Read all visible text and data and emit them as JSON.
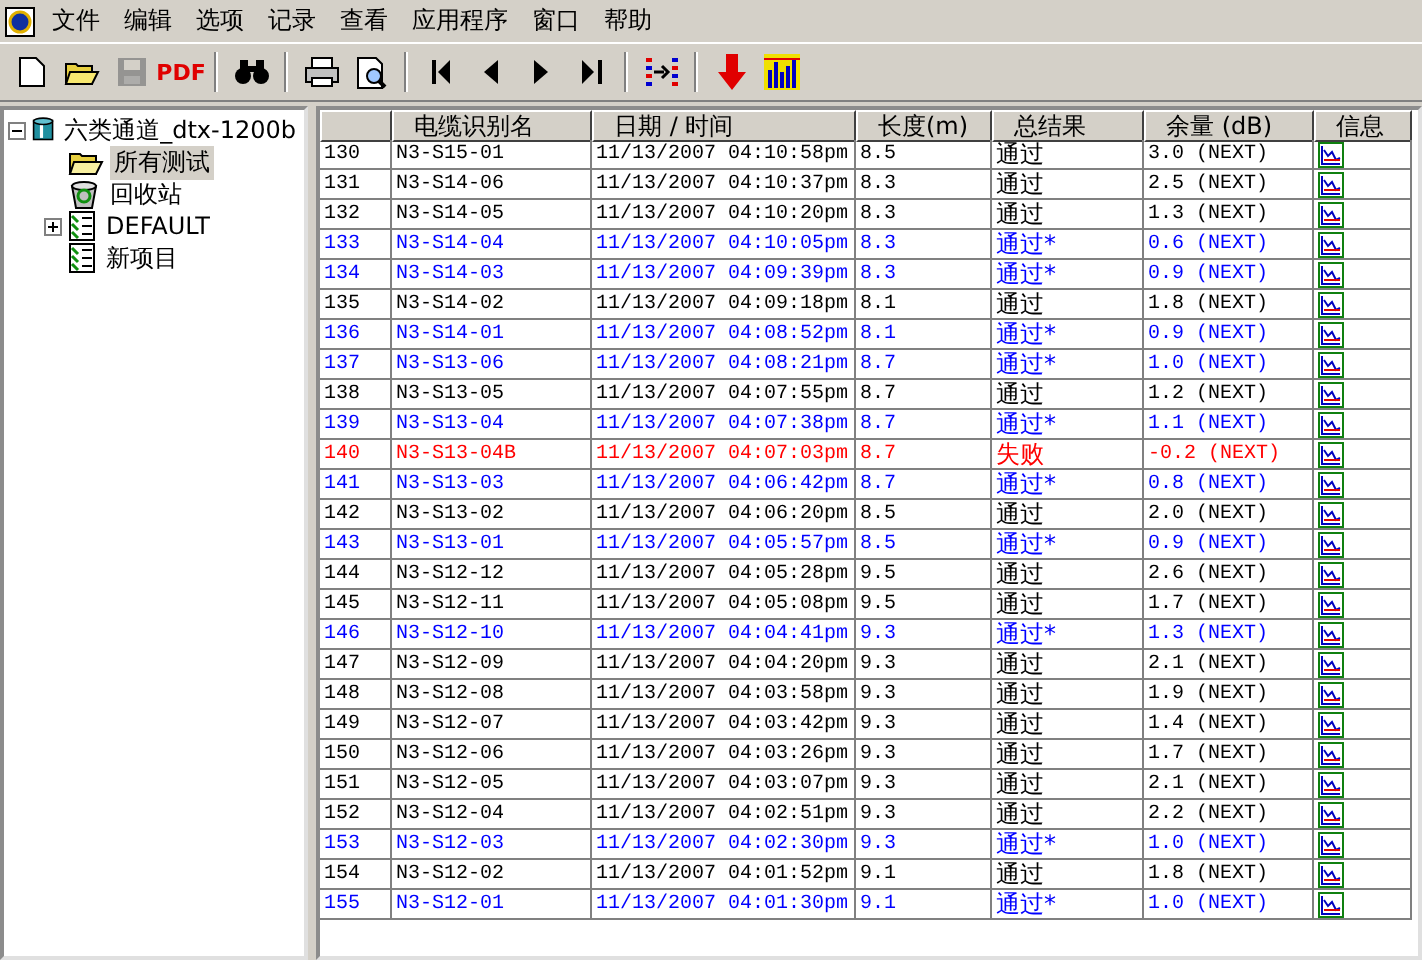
{
  "menu": [
    "文件",
    "编辑",
    "选项",
    "记录",
    "查看",
    "应用程序",
    "窗口",
    "帮助"
  ],
  "toolbar": [
    {
      "kind": "new",
      "disabled": false
    },
    {
      "kind": "open",
      "disabled": false
    },
    {
      "kind": "save",
      "disabled": true
    },
    {
      "kind": "pdf",
      "label": "PDF",
      "disabled": false
    },
    {
      "kind": "sep"
    },
    {
      "kind": "find",
      "disabled": false
    },
    {
      "kind": "sep"
    },
    {
      "kind": "print",
      "disabled": false
    },
    {
      "kind": "preview",
      "disabled": false
    },
    {
      "kind": "sep"
    },
    {
      "kind": "first",
      "disabled": false
    },
    {
      "kind": "prev",
      "disabled": false
    },
    {
      "kind": "next",
      "disabled": false
    },
    {
      "kind": "last",
      "disabled": false
    },
    {
      "kind": "sep"
    },
    {
      "kind": "compare",
      "disabled": false
    },
    {
      "kind": "sep"
    },
    {
      "kind": "down",
      "disabled": false
    },
    {
      "kind": "chart",
      "disabled": false
    }
  ],
  "tree": [
    {
      "label": "六类通道_dtx-1200b",
      "kind": "project",
      "expanded": true,
      "selected": false,
      "children": [
        {
          "label": "所有测试",
          "kind": "folder",
          "selected": true
        },
        {
          "label": "回收站",
          "kind": "trash",
          "selected": false
        },
        {
          "label": "DEFAULT",
          "kind": "list",
          "expanded": false,
          "selected": false
        },
        {
          "label": "新项目",
          "kind": "list",
          "selected": false
        }
      ]
    }
  ],
  "table": {
    "columns": [
      "",
      "电缆识别名",
      "日期 / 时间",
      "长度(m)",
      "总结果",
      "余量 (dB)",
      "信息"
    ],
    "rows": [
      {
        "no": "130",
        "name": "N3-S15-01",
        "datetime": "11/13/2007 04:10:58pm",
        "length": "8.5",
        "result": "通过",
        "margin": "3.0 (NEXT)",
        "color": "#000000"
      },
      {
        "no": "131",
        "name": "N3-S14-06",
        "datetime": "11/13/2007 04:10:37pm",
        "length": "8.3",
        "result": "通过",
        "margin": "2.5 (NEXT)",
        "color": "#000000"
      },
      {
        "no": "132",
        "name": "N3-S14-05",
        "datetime": "11/13/2007 04:10:20pm",
        "length": "8.3",
        "result": "通过",
        "margin": "1.3 (NEXT)",
        "color": "#000000"
      },
      {
        "no": "133",
        "name": "N3-S14-04",
        "datetime": "11/13/2007 04:10:05pm",
        "length": "8.3",
        "result": "通过*",
        "margin": "0.6 (NEXT)",
        "color": "#0000ff"
      },
      {
        "no": "134",
        "name": "N3-S14-03",
        "datetime": "11/13/2007 04:09:39pm",
        "length": "8.3",
        "result": "通过*",
        "margin": "0.9 (NEXT)",
        "color": "#0000ff"
      },
      {
        "no": "135",
        "name": "N3-S14-02",
        "datetime": "11/13/2007 04:09:18pm",
        "length": "8.1",
        "result": "通过",
        "margin": "1.8 (NEXT)",
        "color": "#000000"
      },
      {
        "no": "136",
        "name": "N3-S14-01",
        "datetime": "11/13/2007 04:08:52pm",
        "length": "8.1",
        "result": "通过*",
        "margin": "0.9 (NEXT)",
        "color": "#0000ff"
      },
      {
        "no": "137",
        "name": "N3-S13-06",
        "datetime": "11/13/2007 04:08:21pm",
        "length": "8.7",
        "result": "通过*",
        "margin": "1.0 (NEXT)",
        "color": "#0000ff"
      },
      {
        "no": "138",
        "name": "N3-S13-05",
        "datetime": "11/13/2007 04:07:55pm",
        "length": "8.7",
        "result": "通过",
        "margin": "1.2 (NEXT)",
        "color": "#000000"
      },
      {
        "no": "139",
        "name": "N3-S13-04",
        "datetime": "11/13/2007 04:07:38pm",
        "length": "8.7",
        "result": "通过*",
        "margin": "1.1 (NEXT)",
        "color": "#0000ff"
      },
      {
        "no": "140",
        "name": "N3-S13-04B",
        "datetime": "11/13/2007 04:07:03pm",
        "length": "8.7",
        "result": "失败",
        "margin": "-0.2 (NEXT)",
        "color": "#ff0000"
      },
      {
        "no": "141",
        "name": "N3-S13-03",
        "datetime": "11/13/2007 04:06:42pm",
        "length": "8.7",
        "result": "通过*",
        "margin": "0.8 (NEXT)",
        "color": "#0000ff"
      },
      {
        "no": "142",
        "name": "N3-S13-02",
        "datetime": "11/13/2007 04:06:20pm",
        "length": "8.5",
        "result": "通过",
        "margin": "2.0 (NEXT)",
        "color": "#000000"
      },
      {
        "no": "143",
        "name": "N3-S13-01",
        "datetime": "11/13/2007 04:05:57pm",
        "length": "8.5",
        "result": "通过*",
        "margin": "0.9 (NEXT)",
        "color": "#0000ff"
      },
      {
        "no": "144",
        "name": "N3-S12-12",
        "datetime": "11/13/2007 04:05:28pm",
        "length": "9.5",
        "result": "通过",
        "margin": "2.6 (NEXT)",
        "color": "#000000"
      },
      {
        "no": "145",
        "name": "N3-S12-11",
        "datetime": "11/13/2007 04:05:08pm",
        "length": "9.5",
        "result": "通过",
        "margin": "1.7 (NEXT)",
        "color": "#000000"
      },
      {
        "no": "146",
        "name": "N3-S12-10",
        "datetime": "11/13/2007 04:04:41pm",
        "length": "9.3",
        "result": "通过*",
        "margin": "1.3 (NEXT)",
        "color": "#0000ff"
      },
      {
        "no": "147",
        "name": "N3-S12-09",
        "datetime": "11/13/2007 04:04:20pm",
        "length": "9.3",
        "result": "通过",
        "margin": "2.1 (NEXT)",
        "color": "#000000"
      },
      {
        "no": "148",
        "name": "N3-S12-08",
        "datetime": "11/13/2007 04:03:58pm",
        "length": "9.3",
        "result": "通过",
        "margin": "1.9 (NEXT)",
        "color": "#000000"
      },
      {
        "no": "149",
        "name": "N3-S12-07",
        "datetime": "11/13/2007 04:03:42pm",
        "length": "9.3",
        "result": "通过",
        "margin": "1.4 (NEXT)",
        "color": "#000000"
      },
      {
        "no": "150",
        "name": "N3-S12-06",
        "datetime": "11/13/2007 04:03:26pm",
        "length": "9.3",
        "result": "通过",
        "margin": "1.7 (NEXT)",
        "color": "#000000"
      },
      {
        "no": "151",
        "name": "N3-S12-05",
        "datetime": "11/13/2007 04:03:07pm",
        "length": "9.3",
        "result": "通过",
        "margin": "2.1 (NEXT)",
        "color": "#000000"
      },
      {
        "no": "152",
        "name": "N3-S12-04",
        "datetime": "11/13/2007 04:02:51pm",
        "length": "9.3",
        "result": "通过",
        "margin": "2.2 (NEXT)",
        "color": "#000000"
      },
      {
        "no": "153",
        "name": "N3-S12-03",
        "datetime": "11/13/2007 04:02:30pm",
        "length": "9.3",
        "result": "通过*",
        "margin": "1.0 (NEXT)",
        "color": "#0000ff"
      },
      {
        "no": "154",
        "name": "N3-S12-02",
        "datetime": "11/13/2007 04:01:52pm",
        "length": "9.1",
        "result": "通过",
        "margin": "1.8 (NEXT)",
        "color": "#000000"
      },
      {
        "no": "155",
        "name": "N3-S12-01",
        "datetime": "11/13/2007 04:01:30pm",
        "length": "9.1",
        "result": "通过*",
        "margin": "1.0 (NEXT)",
        "color": "#0000ff"
      }
    ]
  }
}
